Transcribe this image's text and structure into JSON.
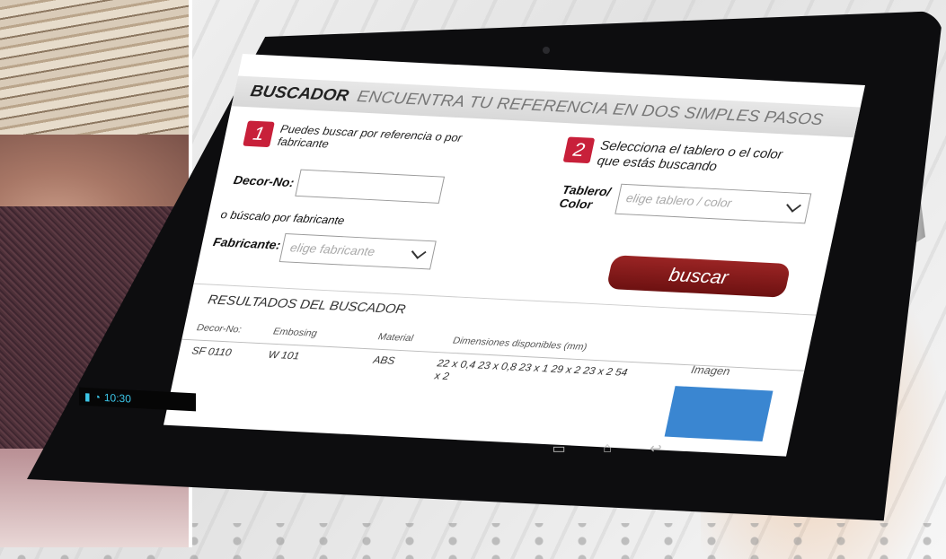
{
  "header": {
    "title": "BUSCADOR",
    "subtitle": "ENCUENTRA TU REFERENCIA EN DOS SIMPLES PASOS"
  },
  "step1": {
    "number": "1",
    "text": "Puedes buscar por referencia o por fabricante"
  },
  "step2": {
    "number": "2",
    "text": "Selecciona el tablero o el color que estás buscando"
  },
  "form": {
    "decor_label": "Decor-No:",
    "decor_value": "",
    "alt_text": "o búscalo por fabricante",
    "fabricante_label": "Fabricante:",
    "fabricante_placeholder": "elige fabricante",
    "tablero_label": "Tablero/ Color",
    "tablero_placeholder": "elige tablero / color",
    "search_button": "buscar"
  },
  "results": {
    "title": "RESULTADOS DEL BUSCADOR",
    "columns": [
      "Decor-No:",
      "Embosing",
      "Material",
      "Dimensiones disponibles (mm)",
      "Imagen"
    ],
    "rows": [
      {
        "decor": "SF 0110",
        "embosing": "W 101",
        "material": "ABS",
        "dimensions": "22 x 0,4   23 x 0,8  23 x 1   29 x 2   23 x 2   54 x 2"
      }
    ]
  },
  "status": {
    "time": "10:30"
  },
  "colors": {
    "accent": "#c8203a",
    "button": "#7f1a1a",
    "thumb": "#3a86d1"
  },
  "icons": [
    "recent-apps-icon",
    "home-icon",
    "back-icon",
    "wifi-icon",
    "battery-icon"
  ]
}
